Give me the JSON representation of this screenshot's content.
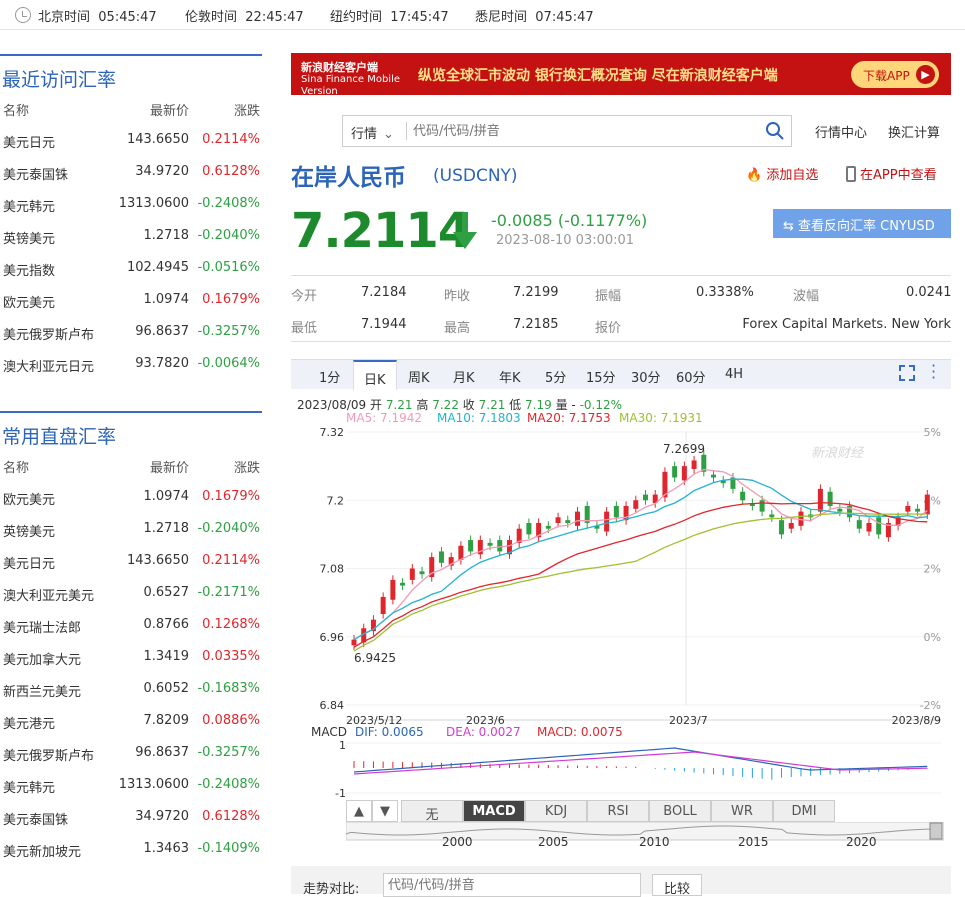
{
  "times": [
    {
      "label": "北京时间",
      "time": "05:45:47"
    },
    {
      "label": "伦敦时间",
      "time": "22:45:47"
    },
    {
      "label": "纽约时间",
      "time": "17:45:47"
    },
    {
      "label": "悉尼时间",
      "time": "07:45:47"
    }
  ],
  "recent": {
    "title": "最近访问汇率",
    "headers": [
      "名称",
      "最新价",
      "涨跌"
    ],
    "rows": [
      [
        "美元日元",
        "143.6650",
        "0.2114%",
        "up"
      ],
      [
        "美元泰国铢",
        "34.9720",
        "0.6128%",
        "up"
      ],
      [
        "美元韩元",
        "1313.0600",
        "-0.2408%",
        "dn"
      ],
      [
        "英镑美元",
        "1.2718",
        "-0.2040%",
        "dn"
      ],
      [
        "美元指数",
        "102.4945",
        "-0.0516%",
        "dn"
      ],
      [
        "欧元美元",
        "1.0974",
        "0.1679%",
        "up"
      ],
      [
        "美元俄罗斯卢布",
        "96.8637",
        "-0.3257%",
        "dn"
      ],
      [
        "澳大利亚元日元",
        "93.7820",
        "-0.0064%",
        "dn"
      ]
    ]
  },
  "common": {
    "title": "常用直盘汇率",
    "headers": [
      "名称",
      "最新价",
      "涨跌"
    ],
    "rows": [
      [
        "欧元美元",
        "1.0974",
        "0.1679%",
        "up"
      ],
      [
        "英镑美元",
        "1.2718",
        "-0.2040%",
        "dn"
      ],
      [
        "美元日元",
        "143.6650",
        "0.2114%",
        "up"
      ],
      [
        "澳大利亚元美元",
        "0.6527",
        "-0.2171%",
        "dn"
      ],
      [
        "美元瑞士法郎",
        "0.8766",
        "0.1268%",
        "up"
      ],
      [
        "美元加拿大元",
        "1.3419",
        "0.0335%",
        "up"
      ],
      [
        "新西兰元美元",
        "0.6052",
        "-0.1683%",
        "dn"
      ],
      [
        "美元港元",
        "7.8209",
        "0.0886%",
        "up"
      ],
      [
        "美元俄罗斯卢布",
        "96.8637",
        "-0.3257%",
        "dn"
      ],
      [
        "美元韩元",
        "1313.0600",
        "-0.2408%",
        "dn"
      ],
      [
        "美元泰国铢",
        "34.9720",
        "0.6128%",
        "up"
      ],
      [
        "美元新加坡元",
        "1.3463",
        "-0.1409%",
        "dn"
      ]
    ]
  },
  "banner": {
    "logo": "新浪财经客户端",
    "logo_en": "Sina Finance Mobile Version",
    "slogan": "纵览全球汇市波动  银行换汇概况查询  尽在新浪财经客户端",
    "download": "下载APP"
  },
  "search": {
    "category": "行情",
    "placeholder": "代码/代码/拼音"
  },
  "links": {
    "center": "行情中心",
    "calc": "换汇计算"
  },
  "quote": {
    "name": "在岸人民币",
    "code": "(USDCNY)",
    "add_fav": "添加自选",
    "app_view": "在APP中查看",
    "price": "7.2114",
    "change": "-0.0085 (-0.1177%)",
    "time": "2023-08-10 03:00:01",
    "reverse": "查看反向汇率 CNYUSD"
  },
  "stats": {
    "open_k": "今开",
    "open": "7.2184",
    "prev_k": "昨收",
    "prev": "7.2199",
    "amp_k": "振幅",
    "amp": "0.3338%",
    "wave_k": "波幅",
    "wave": "0.0241",
    "low_k": "最低",
    "low": "7.1944",
    "high_k": "最高",
    "high": "7.2185",
    "quote_k": "报价",
    "quote": "Forex Capital Markets. New York"
  },
  "tabs": [
    "1分",
    "日K",
    "周K",
    "月K",
    "年K",
    "5分",
    "15分",
    "30分",
    "60分",
    "4H"
  ],
  "ohlc": {
    "date": "2023/08/09",
    "open_k": "开",
    "open": "7.21",
    "high_k": "高",
    "high": "7.22",
    "close_k": "收",
    "close": "7.21",
    "low_k": "低",
    "low": "7.19",
    "vol_k": "量",
    "vol": "-",
    "pct": "-0.12%"
  },
  "ma": {
    "ma5": "MA5: 7.1942",
    "ma10": "MA10: 7.1803",
    "ma20": "MA20: 7.1753",
    "ma30": "MA30: 7.1931"
  },
  "chart_data": {
    "type": "candlestick",
    "ylim": [
      6.84,
      7.32
    ],
    "yticks": [
      "7.32",
      "7.2",
      "7.08",
      "6.96",
      "6.84"
    ],
    "pct_ticks": [
      "5%",
      "4%",
      "2%",
      "0%",
      "-2%"
    ],
    "xticks": [
      "2023/5/12",
      "2023/6",
      "2023/7",
      "2023/8/9"
    ],
    "max_label": "7.2699",
    "min_label": "6.9425",
    "watermark": "新浪财经",
    "closes": [
      6.955,
      6.975,
      6.99,
      7.03,
      7.06,
      7.05,
      7.08,
      7.07,
      7.1,
      7.09,
      7.1,
      7.12,
      7.11,
      7.13,
      7.12,
      7.11,
      7.13,
      7.15,
      7.14,
      7.16,
      7.15,
      7.17,
      7.16,
      7.18,
      7.16,
      7.15,
      7.18,
      7.17,
      7.19,
      7.2,
      7.2,
      7.21,
      7.25,
      7.24,
      7.26,
      7.27,
      7.25,
      7.24,
      7.23,
      7.22,
      7.2,
      7.19,
      7.18,
      7.17,
      7.14,
      7.16,
      7.18,
      7.17,
      7.22,
      7.19,
      7.18,
      7.17,
      7.15,
      7.16,
      7.14,
      7.16,
      7.17,
      7.19,
      7.18,
      7.21
    ]
  },
  "macd": {
    "label": "MACD",
    "dif": "DIF: 0.0065",
    "dea": "DEA: 0.0027",
    "macd": "MACD: 0.0075",
    "top": "1",
    "bottom": "-1"
  },
  "indicators": [
    "无",
    "MACD",
    "KDJ",
    "RSI",
    "BOLL",
    "WR",
    "DMI"
  ],
  "nav_years": [
    "2000",
    "2005",
    "2010",
    "2015",
    "2020"
  ],
  "compare": {
    "label": "走势对比:",
    "placeholder": "代码/代码/拼音",
    "button": "比较"
  }
}
